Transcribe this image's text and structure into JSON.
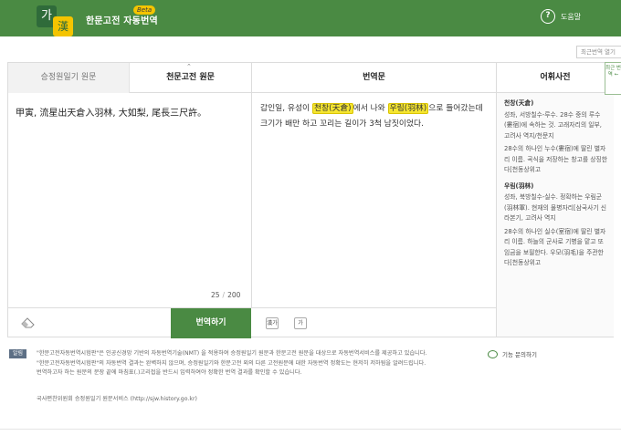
{
  "header": {
    "logo_char_1": "가",
    "logo_char_2": "漢",
    "title": "한문고전 자동번역",
    "beta": "Beta",
    "help_label": "도움말"
  },
  "recent_label": "최근번역 열기",
  "tabs": {
    "source_left": "승정원일기 원문",
    "source_active": "천문고전 원문",
    "translation_header": "번역문"
  },
  "source": {
    "text": "甲寅, 流星出天倉入羽林, 大如梨, 尾長三尺許。",
    "count": "25",
    "max": "200"
  },
  "translation": {
    "p1": "갑인일, 유성이 ",
    "h1": "천창(天倉)",
    "p2": "에서 나와 ",
    "h2": "우림(羽林)",
    "p3": "으로 들어갔는데 크기가 배만 하고 꼬리는 길이가 3척 남짓이었다."
  },
  "buttons": {
    "translate": "번역하기",
    "icon_btn_1": "漢가",
    "icon_btn_2": "가"
  },
  "dictionary": {
    "title": "어휘사전",
    "side_tab": "최근 번역 ←",
    "entries": [
      {
        "term": "천창(天倉)",
        "def1": "성좌, 서방칠수-루수. 28수 중의 루수(婁宿)에 속하는 것. 고래자리의 일부, 고려사 역지/천문지",
        "def2": "28수의 하나인 누수(婁宿)에 딸린 별자리 이름. 곡식을 저장하는 창고를 상징한다[천동상위고"
      },
      {
        "term": "우림(羽林)",
        "def1": "성좌, 북방칠수-실수. 정확하는 우림군(羽林軍). 현재의 물병자리[삼국사기 신라본기, 고려사 역지",
        "def2": "28수의 하나인 실수(室宿)에 딸린 별자리 이름. 하늘의 군사로 기병을 맡고 또 임금을 보필한다. 우모(羽毛)을 주관한다[천동상위고"
      }
    ]
  },
  "notice": {
    "badge": "알림",
    "line1": "\"한문고전자동번역시험판\"은 인공신경망 기반의 자동번역기술(NMT) 을 적용하여 승정원일기 원문과 한문고전 원문을 대상으로 자동번역서비스를 제공하고 있습니다.",
    "line2": "\"한문고전자동번역시험판\"의 자동번역 결과는 완벽하지 않으며, 승정원일기와 한문고전 외의 다른 고전원문에 대한 자동번역 정확도는 현저히 저하됨을 알려드립니다.",
    "line3": "번역하고자 하는 원문의 문장 끝에 마침표(.)고리접을 반드시 입력하여야 정확한 번역 결과를 확인할 수 있습니다.",
    "service": "국사편찬위원회 승정원일기 원문서비스 (http://sjw.history.go.kr)",
    "faq": "기능 문의하기"
  }
}
